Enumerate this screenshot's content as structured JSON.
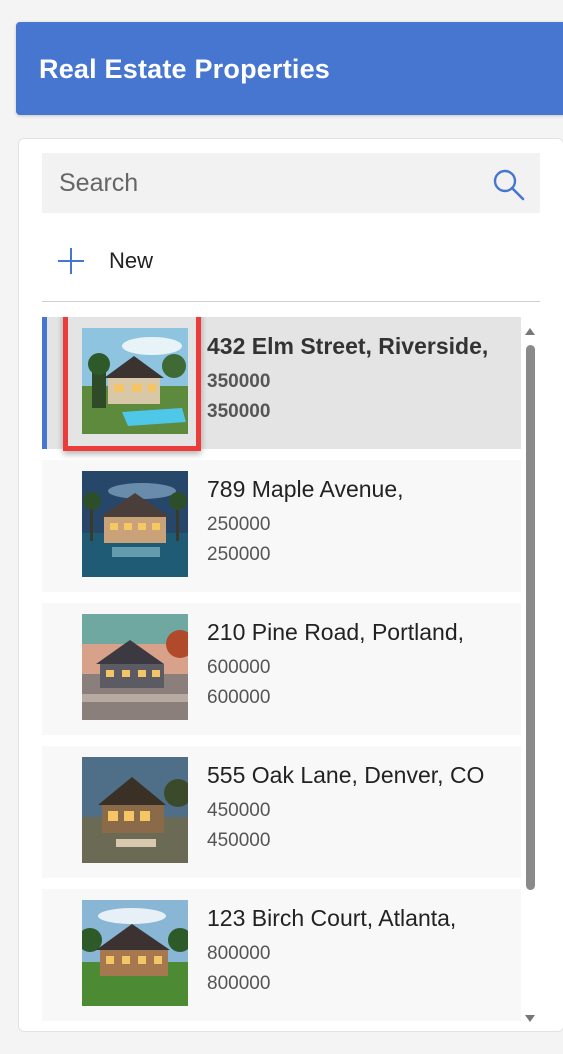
{
  "header": {
    "title": "Real Estate Properties"
  },
  "search": {
    "placeholder": "Search",
    "value": ""
  },
  "toolbar": {
    "new_label": "New"
  },
  "accent_color": "#4676d0",
  "highlight_color": "#ec3b3b",
  "properties": [
    {
      "title": "432 Elm Street, Riverside,",
      "price": "350000",
      "price2": "350000",
      "selected": true
    },
    {
      "title": "789 Maple Avenue,",
      "price": "250000",
      "price2": "250000"
    },
    {
      "title": "210 Pine Road, Portland,",
      "price": "600000",
      "price2": "600000"
    },
    {
      "title": "555 Oak Lane, Denver, CO",
      "price": "450000",
      "price2": "450000"
    },
    {
      "title": "123 Birch Court, Atlanta,",
      "price": "800000",
      "price2": "800000"
    }
  ]
}
